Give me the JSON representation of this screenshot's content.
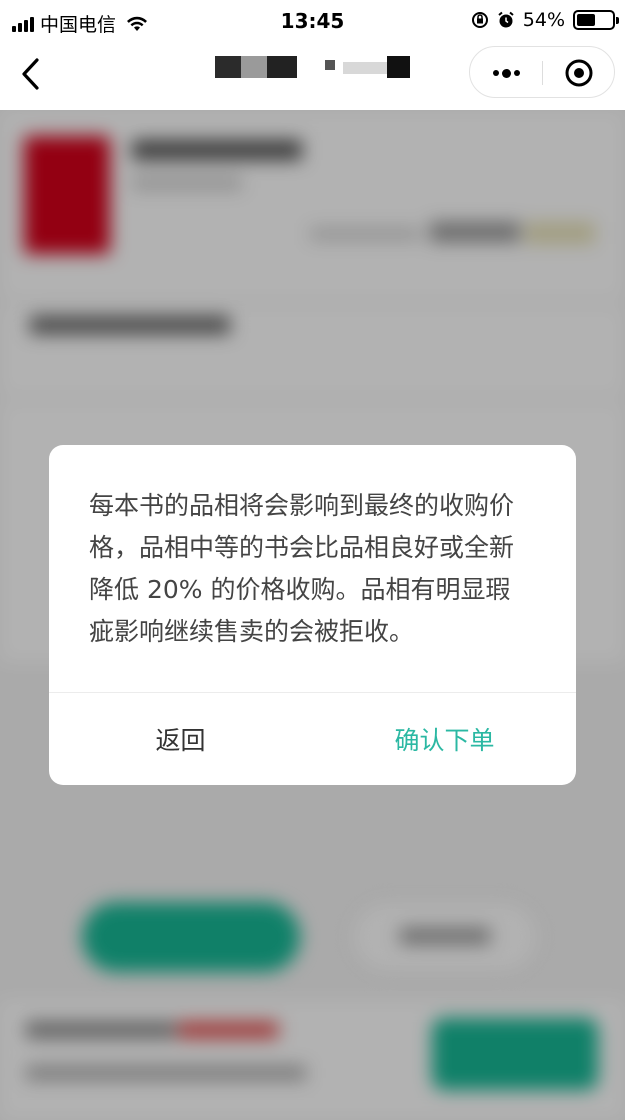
{
  "status_bar": {
    "carrier": "中国电信",
    "time": "13:45",
    "battery_percent": "54%",
    "battery_level": 0.54,
    "icons": [
      "signal-icon",
      "wifi-icon",
      "orientation-lock-icon",
      "alarm-icon",
      "battery-icon"
    ]
  },
  "nav": {
    "back_icon": "chevron-left-icon",
    "more_icon": "more-dots-icon",
    "close_icon": "target-close-icon"
  },
  "dialog": {
    "message": "每本书的品相将会影响到最终的收购价格，品相中等的书会比品相良好或全新降低 20% 的价格收购。品相有明显瑕疵影响继续售卖的会被拒收。",
    "back_label": "返回",
    "confirm_label": "确认下单"
  },
  "colors": {
    "accent": "#2bb8a3",
    "overlay": "rgba(0,0,0,0.30)",
    "book_cover": "#d3001a"
  }
}
